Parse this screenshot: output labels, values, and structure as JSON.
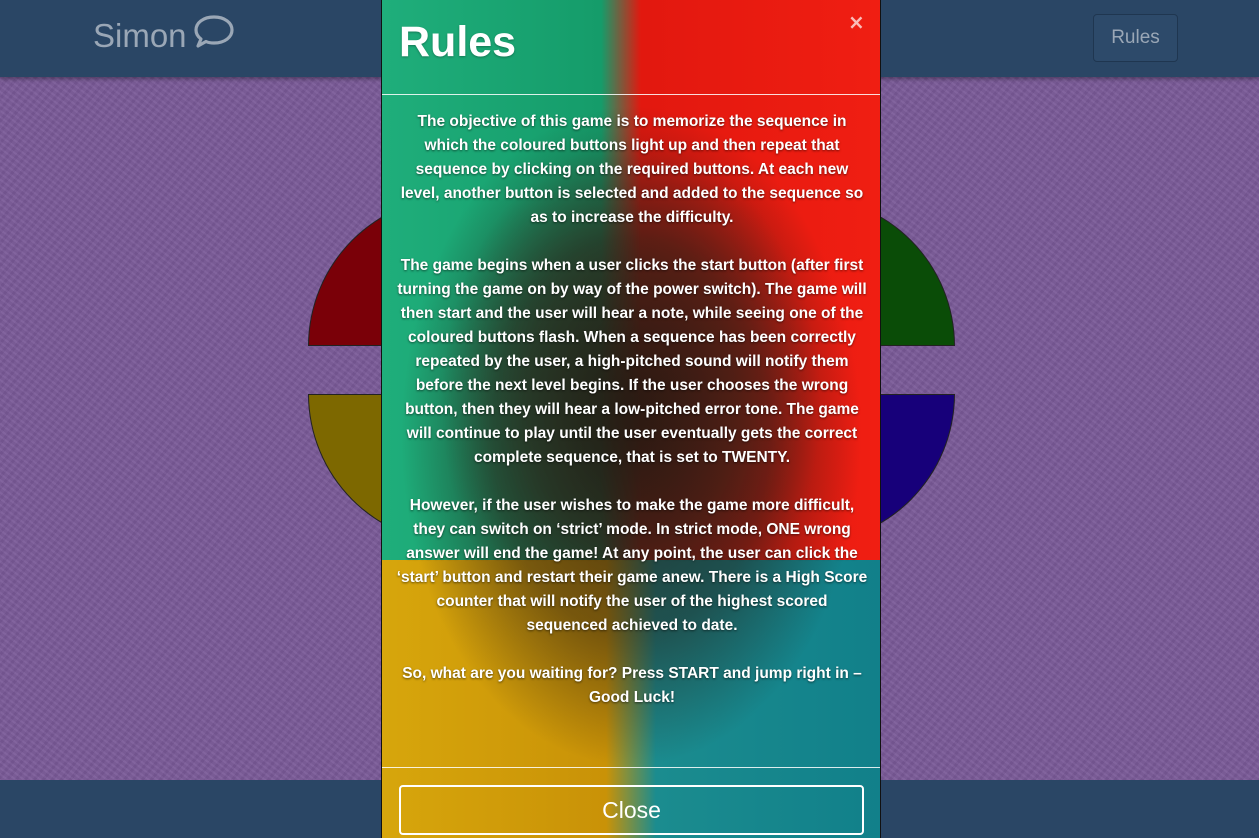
{
  "navbar": {
    "brand": "Simon",
    "brand_icon": "speech-bubble-icon",
    "rules_button": "Rules"
  },
  "board": {
    "colors": {
      "red": "#7a0008",
      "green": "#0a4c07",
      "yellow": "#7d6800",
      "blue": "#17007a"
    }
  },
  "modal": {
    "title": "Rules",
    "close_icon": "×",
    "paragraphs": [
      "The objective of this game is to memorize the sequence in which the coloured buttons light up and then repeat that sequence by clicking on the required buttons. At each new level, another button is selected and added to the sequence so as to increase the difficulty.",
      "The game begins when a user clicks the start button (after first turning the game on by way of the power switch). The game will then start and the user will hear a note, while seeing one of the coloured buttons flash. When a sequence has been correctly repeated by the user, a high-pitched sound will notify them before the next level begins. If the user chooses the wrong button, then they will hear a low-pitched error tone. The game will continue to play until the user eventually gets the correct complete sequence, that is set to TWENTY.",
      "However, if the user wishes to make the game more difficult, they can switch on ‘strict’ mode. In strict mode, ONE wrong answer will end the game! At any point, the user can click the ‘start’ button and restart their game anew. There is a High Score counter that will notify the user of the highest scored sequenced achieved to date.",
      "So, what are you waiting for? Press START and jump right in – Good Luck!"
    ],
    "close_button": "Close"
  }
}
